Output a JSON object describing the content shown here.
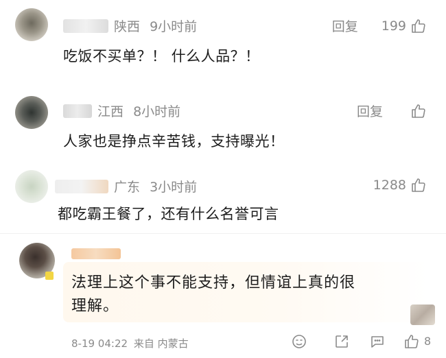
{
  "comments": [
    {
      "location": "陕西",
      "time": "9小时前",
      "reply": "回复",
      "likes": "199",
      "text": "吃饭不买单？！ 什么人品？！"
    },
    {
      "location": "江西",
      "time": "8小时前",
      "reply": "回复",
      "likes": "",
      "text": "人家也是挣点辛苦钱，支持曝光！"
    },
    {
      "location": "广东",
      "time": "3小时前",
      "reply": "",
      "likes": "1288",
      "text": "都吃霸王餐了，还有什么名誉可言"
    }
  ],
  "featured": {
    "line1": "法理上这个事不能支持，但情谊上真的很",
    "line2": "理解。",
    "date": "8-19 04:22",
    "source": "来自 内蒙古",
    "likes": "8"
  },
  "icons": {
    "like": "thumbs-up-icon",
    "emoji": "emoji-icon",
    "share": "share-icon",
    "comment": "comment-icon"
  }
}
